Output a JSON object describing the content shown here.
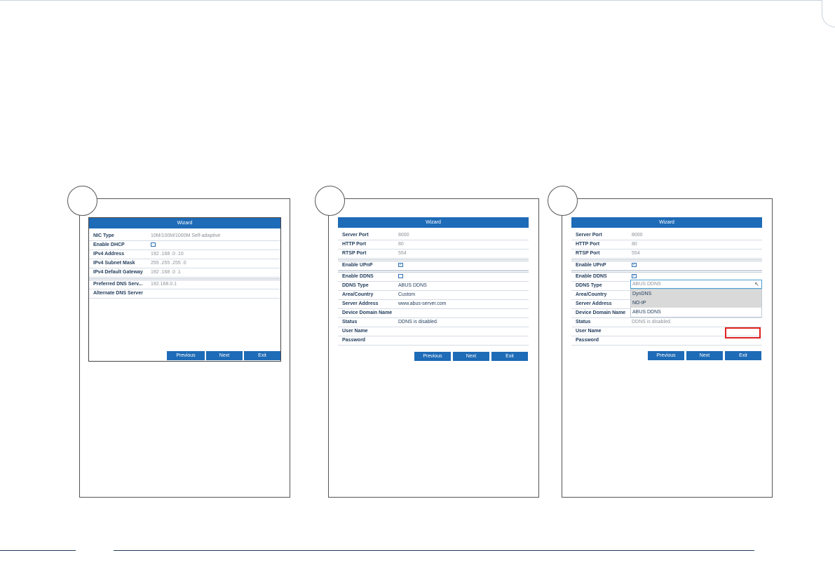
{
  "screens": [
    {
      "title": "Wizard",
      "rows": [
        {
          "label": "NIC Type",
          "value": "10M/100M/1000M Self-adaptive"
        },
        {
          "label": "Enable DHCP"
        },
        {
          "label": "IPv4 Address",
          "value": "192 .168 .0    .10"
        },
        {
          "label": "IPv4 Subnet Mask",
          "value": "255 .255 .255 .0"
        },
        {
          "label": "IPv4 Default Gateway",
          "value": "192 .168 .0    .1"
        },
        {
          "label": "Preferred DNS Serv...",
          "value": "192.168.0.1"
        },
        {
          "label": "Alternate DNS Server"
        }
      ],
      "buttons": {
        "previous": "Previous",
        "next": "Next",
        "exit": "Exit"
      }
    },
    {
      "title": "Wizard",
      "rows": [
        {
          "label": "Server Port",
          "value": "8000"
        },
        {
          "label": "HTTP Port",
          "value": "80"
        },
        {
          "label": "RTSP Port",
          "value": "554"
        },
        {
          "label": "Enable UPnP"
        },
        {
          "label": "Enable DDNS"
        },
        {
          "label": "DDNS Type",
          "value": "ABUS DDNS"
        },
        {
          "label": "Area/Country",
          "value": "Custom"
        },
        {
          "label": "Server Address",
          "value": "www.abus-server.com"
        },
        {
          "label": "Device Domain Name"
        },
        {
          "label": "Status",
          "value": "DDNS is disabled."
        },
        {
          "label": "User Name"
        },
        {
          "label": "Password"
        }
      ],
      "buttons": {
        "previous": "Previous",
        "next": "Next",
        "exit": "Exit"
      }
    },
    {
      "title": "Wizard",
      "rows": [
        {
          "label": "Server Port",
          "value": "8000"
        },
        {
          "label": "HTTP Port",
          "value": "80"
        },
        {
          "label": "RTSP Port",
          "value": "554"
        },
        {
          "label": "Enable UPnP"
        },
        {
          "label": "Enable DDNS"
        },
        {
          "label": "DDNS Type"
        },
        {
          "label": "Area/Country"
        },
        {
          "label": "Server Address"
        },
        {
          "label": "Device Domain Name"
        },
        {
          "label": "Status",
          "value": "DDNS is disabled."
        },
        {
          "label": "User Name"
        },
        {
          "label": "Password"
        }
      ],
      "ddns_dropdown": {
        "selected": "ABUS DDNS",
        "options": [
          "DynDNS",
          "NO-IP",
          "ABUS DDNS"
        ]
      },
      "buttons": {
        "previous": "Previous",
        "next": "Next",
        "exit": "Exit"
      }
    }
  ],
  "checkbox_states": {
    "screen1_enable_dhcp": false,
    "screen2_enable_upnp": true,
    "screen2_enable_ddns": false,
    "screen3_enable_upnp": true,
    "screen3_enable_ddns": true
  },
  "icons": {
    "checkbox_checked": "✓",
    "cursor": "mouse-pointer-icon"
  },
  "colors": {
    "title_bar": "#1e6bb7",
    "highlight_box": "#e02020",
    "rule": "#1f3a5a"
  }
}
